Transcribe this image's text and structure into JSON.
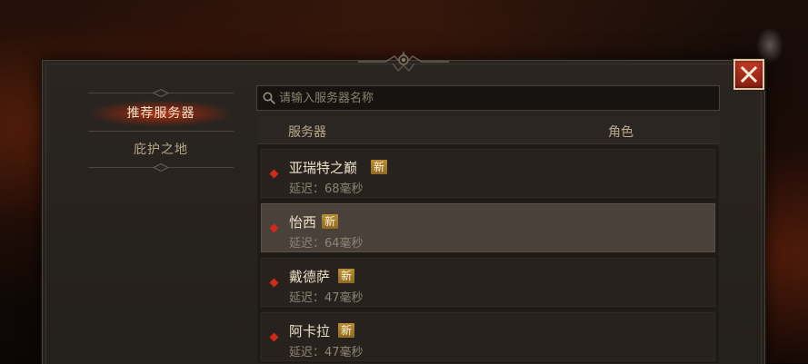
{
  "sidebar": {
    "items": [
      {
        "label": "推荐服务器",
        "active": true
      },
      {
        "label": "庇护之地",
        "active": false
      }
    ]
  },
  "search": {
    "placeholder": "请输入服务器名称",
    "value": ""
  },
  "table": {
    "headers": {
      "server": "服务器",
      "role": "角色"
    },
    "rows": [
      {
        "name": "亚瑞特之巅",
        "badge": "新",
        "latency": "延迟：68毫秒",
        "selected": false
      },
      {
        "name": "怡西",
        "badge": "新",
        "latency": "延迟：64毫秒",
        "selected": true
      },
      {
        "name": "戴德萨",
        "badge": "新",
        "latency": "延迟：47毫秒",
        "selected": false
      },
      {
        "name": "阿卡拉",
        "badge": "新",
        "latency": "延迟：47毫秒",
        "selected": false
      }
    ]
  },
  "icons": {
    "close": "close-icon",
    "search": "search-icon",
    "status": "diamond-icon"
  },
  "colors": {
    "accent_red": "#d02a18",
    "badge_gold": "#b88d37",
    "text_primary": "#ece0c6"
  }
}
